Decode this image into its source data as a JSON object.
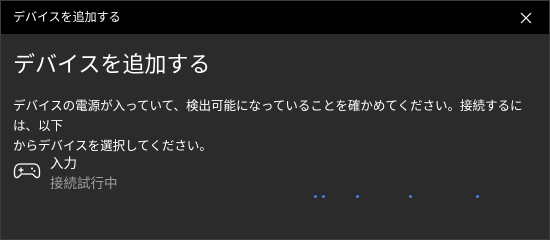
{
  "window": {
    "title": "デバイスを追加する",
    "close_icon": "close-icon"
  },
  "content": {
    "heading": "デバイスを追加する",
    "description_line1": "デバイスの電源が入っていて、検出可能になっていることを確かめてください。接続するには、以下",
    "description_line2": "からデバイスを選択してください。"
  },
  "device": {
    "icon": "gamepad-icon",
    "name": "入力",
    "status": "接続試行中"
  },
  "progress": {
    "type": "indeterminate",
    "color": "#4a7fd0"
  }
}
